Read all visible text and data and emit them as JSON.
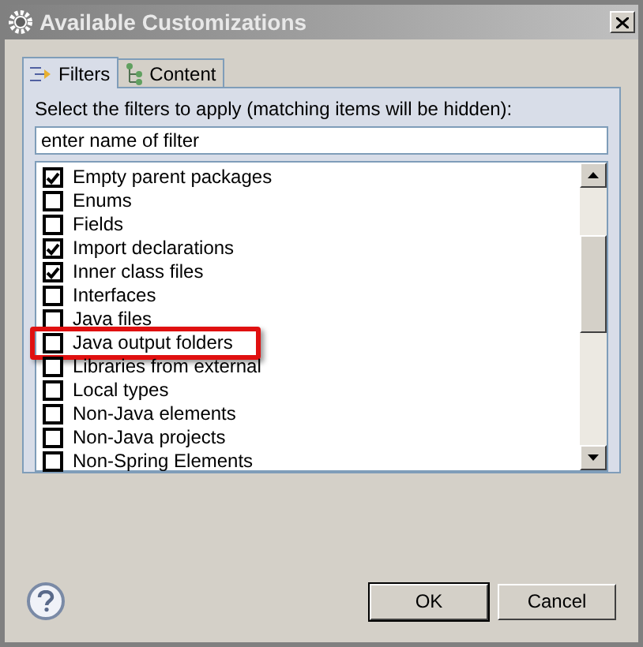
{
  "window": {
    "title": "Available Customizations"
  },
  "tabs": [
    {
      "label": "Filters",
      "selected": true
    },
    {
      "label": "Content",
      "selected": false
    }
  ],
  "instruction": "Select the filters to apply (matching items will be hidden):",
  "filter_field": {
    "value": "enter name of filter"
  },
  "filters": [
    {
      "label": "Empty parent packages",
      "checked": true,
      "highlighted": false
    },
    {
      "label": "Enums",
      "checked": false,
      "highlighted": false
    },
    {
      "label": "Fields",
      "checked": false,
      "highlighted": false
    },
    {
      "label": "Import declarations",
      "checked": true,
      "highlighted": false
    },
    {
      "label": "Inner class files",
      "checked": true,
      "highlighted": false
    },
    {
      "label": "Interfaces",
      "checked": false,
      "highlighted": false
    },
    {
      "label": "Java files",
      "checked": false,
      "highlighted": false
    },
    {
      "label": "Java output folders",
      "checked": false,
      "highlighted": true
    },
    {
      "label": "Libraries from external",
      "checked": false,
      "highlighted": false
    },
    {
      "label": "Local types",
      "checked": false,
      "highlighted": false
    },
    {
      "label": "Non-Java elements",
      "checked": false,
      "highlighted": false
    },
    {
      "label": "Non-Java projects",
      "checked": false,
      "highlighted": false
    },
    {
      "label": "Non-Spring Elements",
      "checked": false,
      "highlighted": false
    }
  ],
  "buttons": [
    "OK",
    "Cancel"
  ]
}
